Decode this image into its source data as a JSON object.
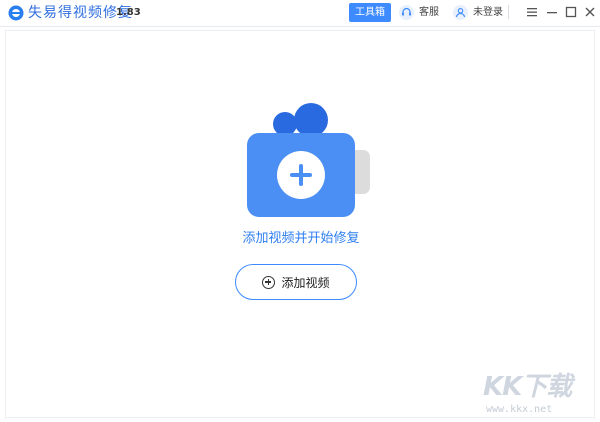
{
  "app": {
    "name": "失易得视频修复",
    "version": "1.83"
  },
  "header": {
    "toolbox_label": "工具箱",
    "service_label": "客服",
    "login_label": "未登录"
  },
  "main": {
    "hint": "添加视频并开始修复",
    "add_button_label": "添加视频"
  },
  "watermark": {
    "logo": "KK下载",
    "url": "www.kkx.net"
  },
  "colors": {
    "accent": "#3d8bff",
    "camera_body": "#4b8ff5",
    "camera_dots": "#2a6ae0",
    "lens": "#dcdcdc"
  }
}
